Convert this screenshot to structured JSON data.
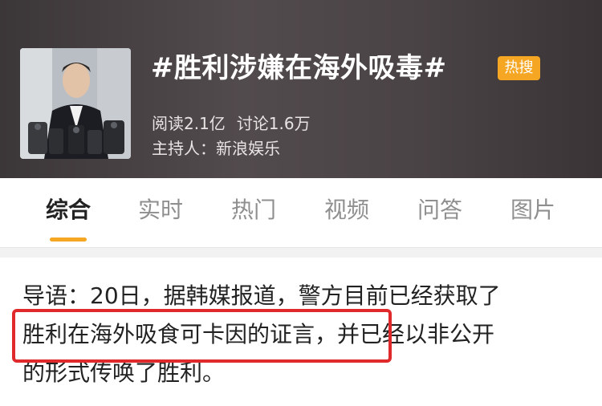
{
  "topic": {
    "title": "#胜利涉嫌在海外吸毒#",
    "badge": "热搜",
    "stats": {
      "reads": "阅读2.1亿",
      "discussions": "讨论1.6万"
    },
    "host": "主持人：新浪娱乐"
  },
  "tabs": [
    {
      "label": "综合",
      "active": true
    },
    {
      "label": "实时",
      "active": false
    },
    {
      "label": "热门",
      "active": false
    },
    {
      "label": "视频",
      "active": false
    },
    {
      "label": "问答",
      "active": false
    },
    {
      "label": "图片",
      "active": false
    }
  ],
  "lead": {
    "lines": [
      "导语：20日，据韩媒报道，警方目前已经获取了",
      "胜利在海外吸食可卡因的证言，并已经以非公开",
      "的形式传唤了胜利。"
    ]
  },
  "colors": {
    "badge": "#f5a623",
    "accent_underline": "#f5a623",
    "highlight_box": "#e0292b"
  }
}
